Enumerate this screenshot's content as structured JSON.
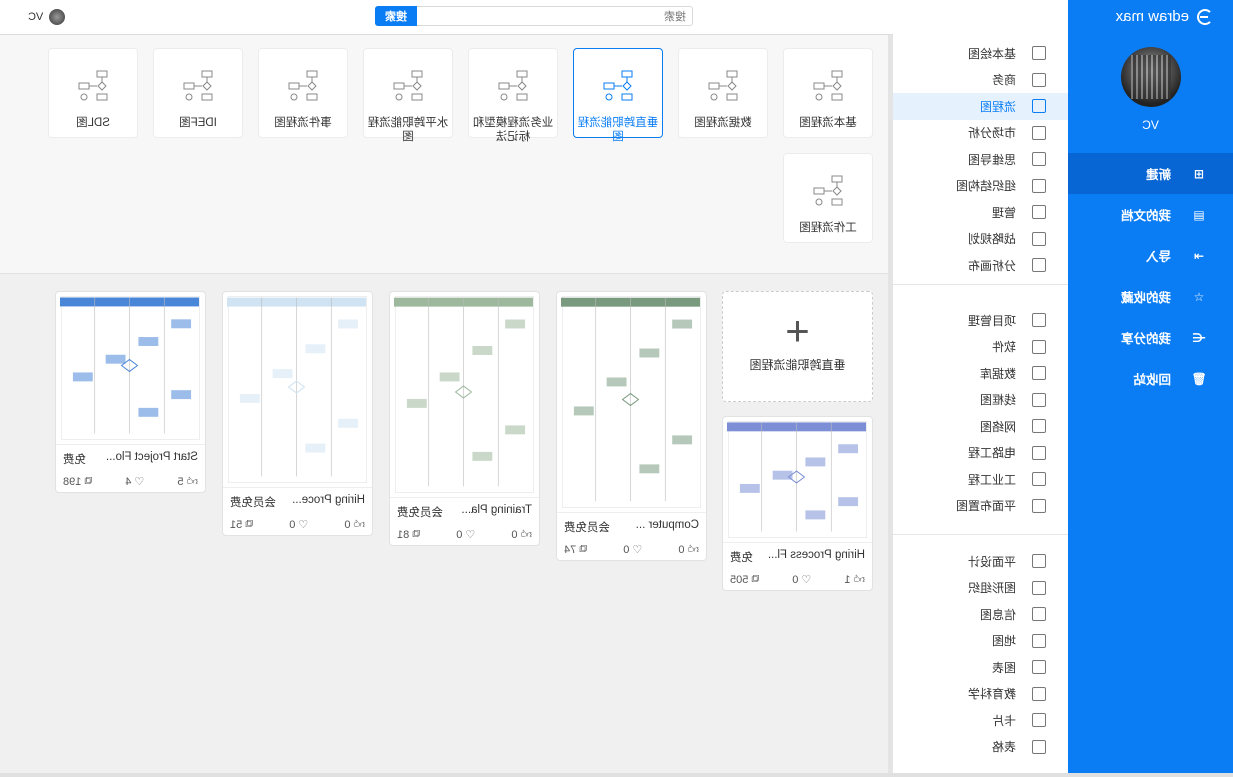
{
  "app": {
    "brand": "edraw max",
    "user_name": "VC"
  },
  "sidebar": {
    "items": [
      {
        "label": "新建",
        "icon": "new-file-icon",
        "active": true
      },
      {
        "label": "我的文档",
        "icon": "document-icon"
      },
      {
        "label": "导入",
        "icon": "import-icon"
      },
      {
        "label": "我的收藏",
        "icon": "star-icon"
      },
      {
        "label": "我的分享",
        "icon": "share-icon"
      },
      {
        "label": "回收站",
        "icon": "trash-icon"
      }
    ]
  },
  "categories": {
    "group1": [
      "基本绘图",
      "商务",
      "流程图",
      "市场分析",
      "思维导图",
      "组织结构图",
      "管理",
      "战略规划",
      "分析画布"
    ],
    "group2": [
      "项目管理",
      "软件",
      "数据库",
      "线框图",
      "网络图",
      "电路工程",
      "工业工程",
      "平面布置图"
    ],
    "group3": [
      "平面设计",
      "图形组织",
      "信息图",
      "地图",
      "图表",
      "教育科学",
      "卡片",
      "表格"
    ],
    "active": "流程图"
  },
  "topbar": {
    "search_placeholder": "搜索",
    "search_button": "搜索",
    "user_name": "VC"
  },
  "diagram_types": [
    {
      "label": "基本流程图"
    },
    {
      "label": "数据流程图"
    },
    {
      "label": "垂直跨职能流程图",
      "active": true
    },
    {
      "label": "业务流程模型和标记法"
    },
    {
      "label": "水平跨职能流程图"
    },
    {
      "label": "事件流程图"
    },
    {
      "label": "IDEF图"
    },
    {
      "label": "SDL图"
    },
    {
      "label": "工作流程图"
    }
  ],
  "new_template": {
    "label": "垂直跨职能流程图"
  },
  "templates": [
    {
      "name": "Hiring Process Fl...",
      "tag": "免费",
      "likes": "1",
      "hearts": "0",
      "copies": "505",
      "theme": "#7c8fd6"
    },
    {
      "name": "Computer ...",
      "tag": "会员免费",
      "likes": "0",
      "hearts": "0",
      "copies": "74",
      "theme": "#7a9a7f"
    },
    {
      "name": "Training Pla...",
      "tag": "会员免费",
      "likes": "0",
      "hearts": "0",
      "copies": "81",
      "theme": "#9db89c"
    },
    {
      "name": "Hiring Proce...",
      "tag": "会员免费",
      "likes": "0",
      "hearts": "0",
      "copies": "51",
      "theme": "#cfe3f3"
    },
    {
      "name": "Start Project Flo...",
      "tag": "免费",
      "likes": "5",
      "hearts": "4",
      "copies": "198",
      "theme": "#4a86d8"
    }
  ],
  "colors": {
    "accent": "#0a7df5",
    "sidebar_active": "#0865d4"
  }
}
